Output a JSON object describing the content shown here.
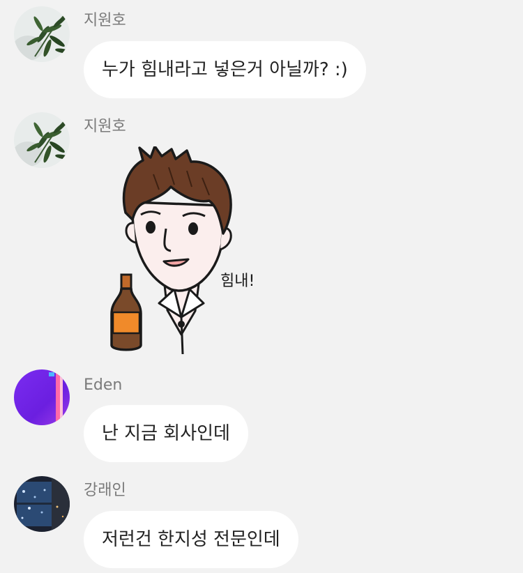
{
  "messages": [
    {
      "sender": "지원호",
      "avatar_icon": "bamboo-leaf-avatar",
      "type": "text",
      "text": "누가 힘내라고 넣은거 아닐까? :)"
    },
    {
      "sender": "지원호",
      "avatar_icon": "bamboo-leaf-avatar",
      "type": "sticker",
      "sticker_caption": "힘내!"
    },
    {
      "sender": "Eden",
      "avatar_icon": "purple-neon-avatar",
      "type": "text",
      "text": "난 지금 회사인데"
    },
    {
      "sender": "강래인",
      "avatar_icon": "night-window-avatar",
      "type": "text",
      "text": "저런건 한지성 전문인데"
    }
  ],
  "colors": {
    "background": "#f2f2f2",
    "bubble": "#ffffff",
    "sender_name": "#7a7a7a",
    "message_text": "#222222"
  }
}
